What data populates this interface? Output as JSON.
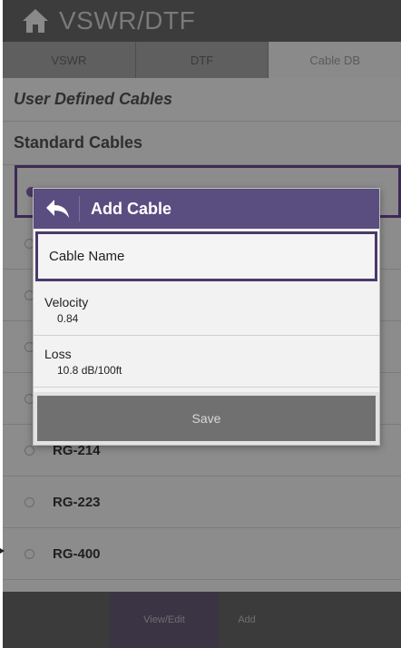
{
  "app": {
    "title": "VSWR/DTF"
  },
  "tabs": [
    {
      "label": "VSWR"
    },
    {
      "label": "DTF"
    },
    {
      "label": "Cable DB"
    }
  ],
  "list": {
    "user_defined_header": "User Defined Cables",
    "standard_header": "Standard Cables",
    "items": [
      {
        "label": ""
      },
      {
        "label": ""
      },
      {
        "label": ""
      },
      {
        "label": ""
      },
      {
        "label": ""
      },
      {
        "label": "RG-214"
      },
      {
        "label": "RG-223"
      },
      {
        "label": "RG-400"
      }
    ]
  },
  "bottom_bar": {
    "view_edit": "View/Edit",
    "add": "Add"
  },
  "dialog": {
    "title": "Add Cable",
    "cable_name_placeholder": "Cable Name",
    "velocity_label": "Velocity",
    "velocity_value": "0.84",
    "loss_label": "Loss",
    "loss_value": "10.8 dB/100ft",
    "save_label": "Save"
  },
  "colors": {
    "accent": "#5a4d80",
    "selection_border": "#3d2a55",
    "background": "#8c8c8c",
    "title_bar": "#3c3c3c"
  }
}
